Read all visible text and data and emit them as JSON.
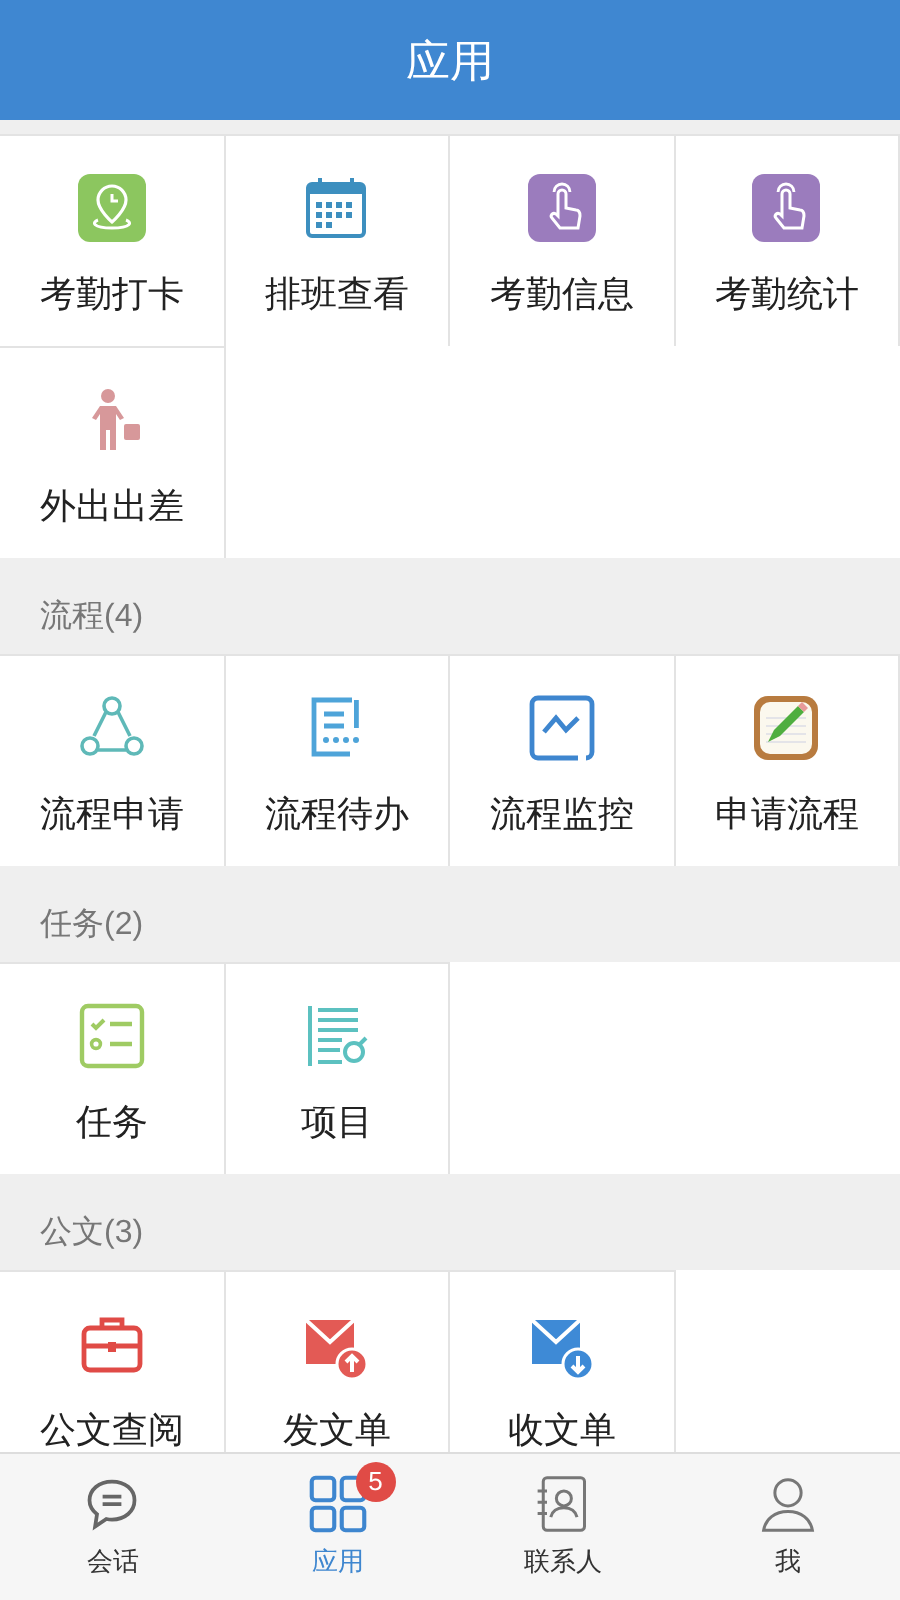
{
  "header": {
    "title": "应用"
  },
  "sections": [
    {
      "items": [
        {
          "label": "考勤打卡",
          "kind": "location"
        },
        {
          "label": "排班查看",
          "kind": "calendar"
        },
        {
          "label": "考勤信息",
          "kind": "tap"
        },
        {
          "label": "考勤统计",
          "kind": "tap"
        },
        {
          "label": "外出出差",
          "kind": "traveler"
        }
      ]
    },
    {
      "title": "流程(4)",
      "items": [
        {
          "label": "流程申请",
          "kind": "nodes"
        },
        {
          "label": "流程待办",
          "kind": "list"
        },
        {
          "label": "流程监控",
          "kind": "chart"
        },
        {
          "label": "申请流程",
          "kind": "notepad"
        }
      ]
    },
    {
      "title": "任务(2)",
      "items": [
        {
          "label": "任务",
          "kind": "checklist"
        },
        {
          "label": "项目",
          "kind": "lines"
        }
      ]
    },
    {
      "title": "公文(3)",
      "items": [
        {
          "label": "公文查阅",
          "kind": "briefcase"
        },
        {
          "label": "发文单",
          "kind": "mailout"
        },
        {
          "label": "收文单",
          "kind": "mailin"
        }
      ]
    }
  ],
  "tabs": [
    {
      "label": "会话",
      "kind": "chat",
      "selected": false
    },
    {
      "label": "应用",
      "kind": "grid",
      "selected": true,
      "badge": "5"
    },
    {
      "label": "联系人",
      "kind": "contacts",
      "selected": false
    },
    {
      "label": "我",
      "kind": "person",
      "selected": false
    }
  ]
}
